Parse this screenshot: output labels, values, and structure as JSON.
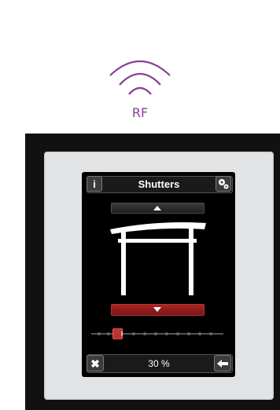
{
  "signal": {
    "label": "RF",
    "color": "#8a3f98",
    "icon": "wifi-signal-icon"
  },
  "window": {
    "title": "Shutters",
    "info_label": "i",
    "settings_icon": "gear-icon",
    "up_button_icon": "arrow-up-icon",
    "down_button_icon": "arrow-down-icon",
    "close_label": "✖",
    "back_icon": "back-arrow-icon",
    "position_text": "30 %",
    "slider_value": 0.2
  },
  "colors": {
    "accent_red": "#a82626",
    "screen": "#000000",
    "frame": "#e2e3e5"
  }
}
